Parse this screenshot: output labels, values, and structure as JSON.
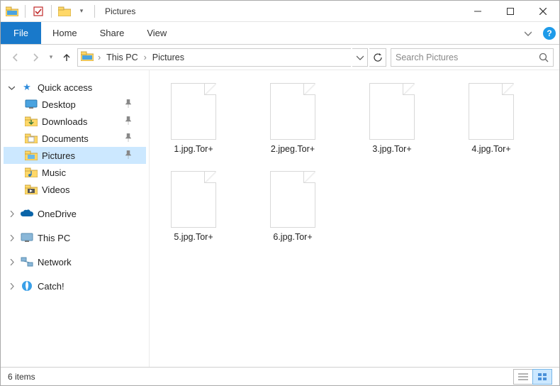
{
  "window": {
    "title": "Pictures"
  },
  "ribbon": {
    "file": "File",
    "tabs": [
      "Home",
      "Share",
      "View"
    ]
  },
  "address": {
    "crumbs": [
      "This PC",
      "Pictures"
    ]
  },
  "search": {
    "placeholder": "Search Pictures"
  },
  "nav": {
    "quick_access": {
      "label": "Quick access",
      "items": [
        {
          "label": "Desktop",
          "pinned": true
        },
        {
          "label": "Downloads",
          "pinned": true
        },
        {
          "label": "Documents",
          "pinned": true
        },
        {
          "label": "Pictures",
          "pinned": true,
          "selected": true
        },
        {
          "label": "Music",
          "pinned": false
        },
        {
          "label": "Videos",
          "pinned": false
        }
      ]
    },
    "onedrive": "OneDrive",
    "thispc": "This PC",
    "network": "Network",
    "catch": "Catch!"
  },
  "files": [
    {
      "name": "1.jpg.Tor+"
    },
    {
      "name": "2.jpeg.Tor+"
    },
    {
      "name": "3.jpg.Tor+"
    },
    {
      "name": "4.jpg.Tor+"
    },
    {
      "name": "5.jpg.Tor+"
    },
    {
      "name": "6.jpg.Tor+"
    }
  ],
  "status": {
    "count": "6 items"
  }
}
